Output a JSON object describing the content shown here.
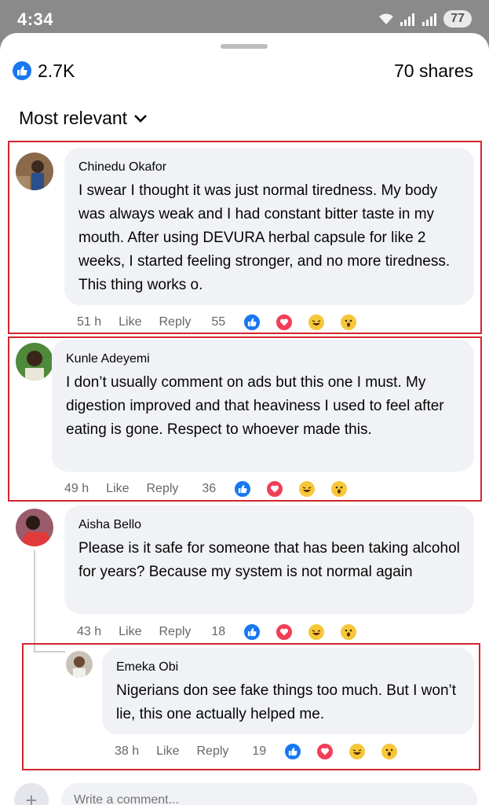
{
  "status": {
    "time": "4:34",
    "battery": "77"
  },
  "header": {
    "likes_count": "2.7K",
    "shares": "70 shares"
  },
  "sort": {
    "label": "Most relevant"
  },
  "comments": [
    {
      "name": "Chinedu Okafor",
      "text": "I swear I thought it was just normal tiredness. My body was always weak and I had constant bitter taste in my mouth. After using DEVURA herbal capsule for like 2 weeks, I started feeling stronger, and no more tiredness. This thing works o.",
      "time": "51 h",
      "like": "Like",
      "reply": "Reply",
      "reactions": "55"
    },
    {
      "name": "Kunle Adeyemi",
      "text": "I don’t usually comment on ads but this one I must. My digestion improved and that heaviness I used to feel after eating is gone. Respect to whoever made this.",
      "time": "49 h",
      "like": "Like",
      "reply": "Reply",
      "reactions": "36"
    },
    {
      "name": "Aisha Bello",
      "text": "Please is it safe for someone that has been taking alcohol for years? Because my system is not normal again",
      "time": "43 h",
      "like": "Like",
      "reply": "Reply",
      "reactions": "18"
    },
    {
      "name": "Emeka Obi",
      "text": "Nigerians don see fake things too much. But I won’t lie, this one actually helped me.",
      "time": "38 h",
      "like": "Like",
      "reply": "Reply",
      "reactions": "19"
    }
  ],
  "composer": {
    "placeholder": "Write a comment..."
  },
  "colors": {
    "accent": "#1877f2",
    "highlight": "#d3262d",
    "bubble": "#f0f2f5"
  }
}
